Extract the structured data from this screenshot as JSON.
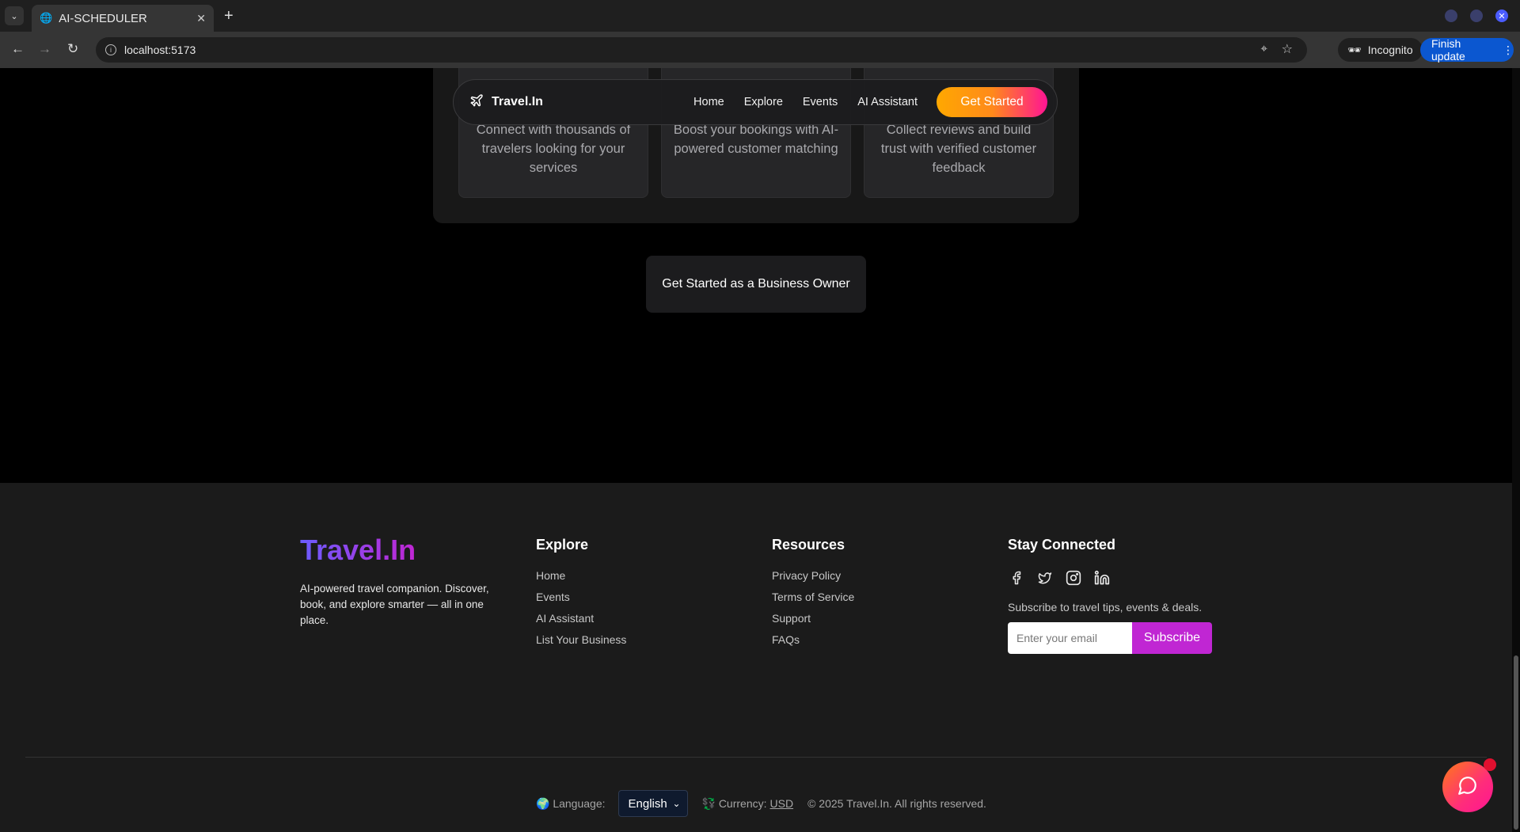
{
  "browser": {
    "tab_title": "AI-SCHEDULER",
    "url": "localhost:5173",
    "incognito_label": "Incognito",
    "update_label": "Finish update"
  },
  "nav": {
    "brand": "Travel.In",
    "links": [
      "Home",
      "Explore",
      "Events",
      "AI Assistant"
    ],
    "cta": "Get Started"
  },
  "features": [
    {
      "text": "Connect with thousands of travelers looking for your services"
    },
    {
      "text": "Boost your bookings with AI-powered customer matching"
    },
    {
      "text": "Collect reviews and build trust with verified customer feedback"
    }
  ],
  "business_cta": "Get Started as a Business Owner",
  "footer": {
    "brand": "Travel.In",
    "tagline": "AI-powered travel companion. Discover, book, and explore smarter — all in one place.",
    "explore": {
      "title": "Explore",
      "links": [
        "Home",
        "Events",
        "AI Assistant",
        "List Your Business"
      ]
    },
    "resources": {
      "title": "Resources",
      "links": [
        "Privacy Policy",
        "Terms of Service",
        "Support",
        "FAQs"
      ]
    },
    "stay": {
      "title": "Stay Connected",
      "social": [
        "facebook-icon",
        "twitter-icon",
        "instagram-icon",
        "linkedin-icon"
      ],
      "subscribe_text": "Subscribe to travel tips, events & deals.",
      "email_placeholder": "Enter your email",
      "subscribe_label": "Subscribe"
    },
    "bottom": {
      "language_label": "🌍 Language:",
      "language_value": "English",
      "currency_label": "💱 Currency:",
      "currency_value": "USD",
      "copyright": "© 2025 Travel.In. All rights reserved."
    }
  },
  "colors": {
    "accent_orange": "#ffa800",
    "accent_pink": "#ff1493",
    "accent_purple": "#c026d3",
    "brand_blue": "#6b5cff"
  }
}
